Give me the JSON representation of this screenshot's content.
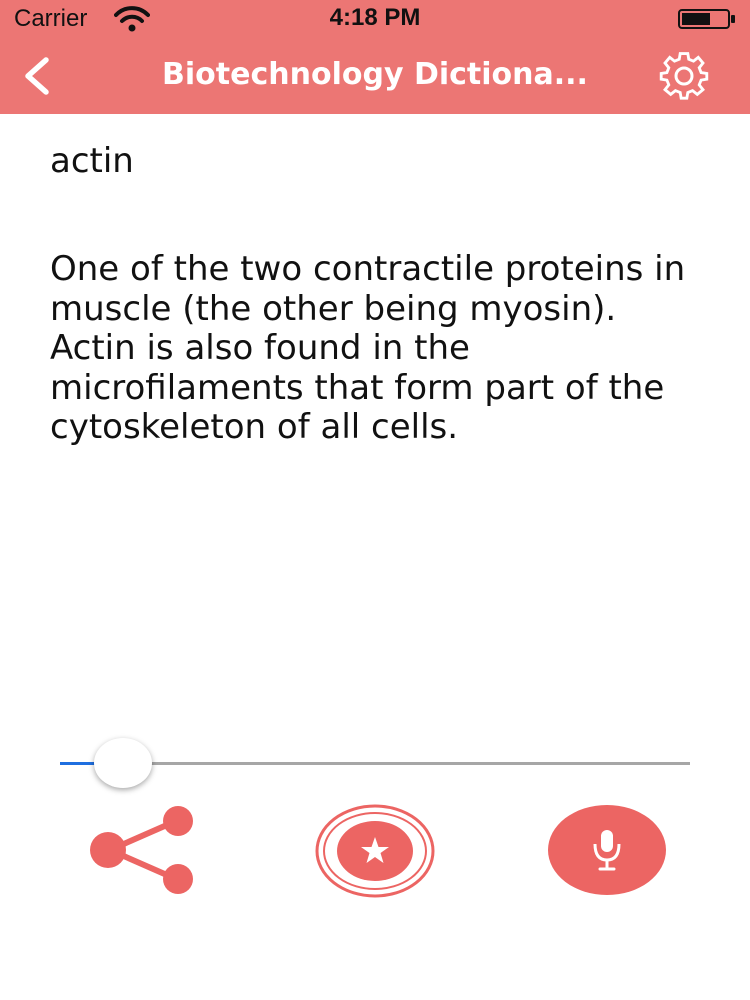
{
  "status_bar": {
    "carrier": "Carrier",
    "time": "4:18 PM"
  },
  "nav": {
    "title": "Biotechnology Dictiona..."
  },
  "entry": {
    "term": "actin",
    "definition": "One of the two contractile proteins in muscle (the other being myosin). Actin is also found in the microfilaments that form part of the cytoskeleton of all cells."
  },
  "speech_slider": {
    "value": 0.1
  },
  "icons": {
    "back": "chevron-left-icon",
    "settings": "gear-icon",
    "share": "share-icon",
    "favorite": "star-icon",
    "microphone": "microphone-icon"
  },
  "colors": {
    "brand": "#ec7674",
    "accent": "#1f6fe0"
  }
}
